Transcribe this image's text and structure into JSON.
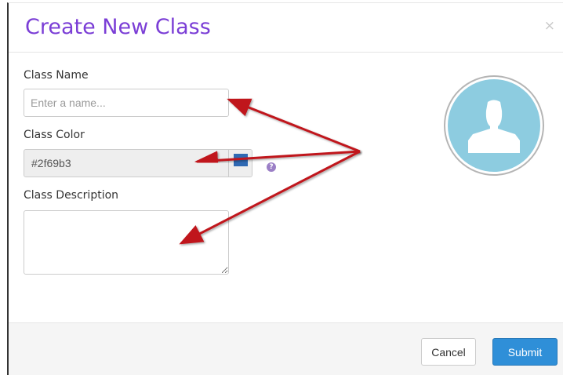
{
  "dialog": {
    "title": "Create New Class",
    "close_label": "×"
  },
  "form": {
    "name_label": "Class Name",
    "name_placeholder": "Enter a name...",
    "name_value": "",
    "color_label": "Class Color",
    "color_value": "#2f69b3",
    "help_glyph": "?",
    "description_label": "Class Description",
    "description_value": ""
  },
  "avatar": {
    "icon": "user-silhouette-icon"
  },
  "footer": {
    "cancel_label": "Cancel",
    "submit_label": "Submit"
  },
  "colors": {
    "title": "#7b3ed6",
    "swatch": "#2f69b3",
    "submit": "#2f8fd8",
    "avatar_bg": "#8dcce0",
    "annotation_arrow": "#c0181e"
  }
}
